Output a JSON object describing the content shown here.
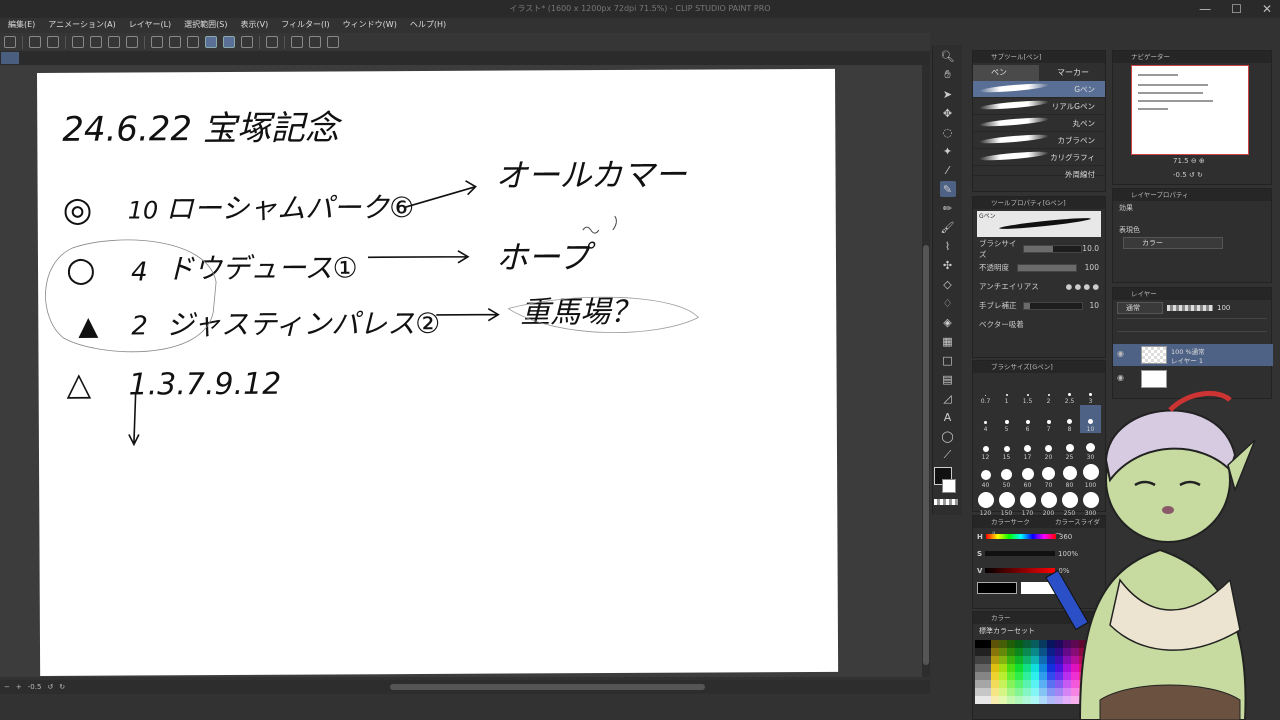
{
  "window": {
    "title": "イラスト* (1600 x 1200px 72dpi 71.5%) - CLIP STUDIO PAINT PRO"
  },
  "menu": [
    "編集(E)",
    "アニメーション(A)",
    "レイヤー(L)",
    "選択範囲(S)",
    "表示(V)",
    "フィルター(I)",
    "ウィンドウ(W)",
    "ヘルプ(H)"
  ],
  "canvas": {
    "title": "24.6.22 宝塚記念",
    "rows": [
      {
        "mark": "◎",
        "num": "10",
        "horse": "ローシャムパーク⑥",
        "note": "オールカマー"
      },
      {
        "mark": "○",
        "num": "4",
        "horse": "ドウデュース①",
        "note": "ホープ"
      },
      {
        "mark": "▲",
        "num": "2",
        "horse": "ジャスティンパレス②",
        "note": "重馬場？"
      },
      {
        "mark": "△",
        "num": "1.3.7.9.12",
        "horse": "",
        "note": ""
      }
    ]
  },
  "status": {
    "zoom": "-0.5"
  },
  "subtool": {
    "title": "サブツール[ペン]",
    "tabs": [
      "ペン",
      "マーカー"
    ],
    "brushes": [
      "Gペン",
      "リアルGペン",
      "丸ペン",
      "カブラペン",
      "カリグラフィ",
      "外周線付"
    ]
  },
  "toolprop": {
    "title": "ツールプロパティ[Gペン]",
    "preset": "Gペン",
    "rows": [
      {
        "label": "ブラシサイズ",
        "value": "10.0",
        "level": 0.5
      },
      {
        "label": "不透明度",
        "value": "100",
        "level": 1.0
      },
      {
        "label": "アンチエイリアス",
        "value": "",
        "level": 0
      },
      {
        "label": "手ブレ補正",
        "value": "10",
        "level": 0.1
      },
      {
        "label": "ベクター吸着",
        "value": "",
        "level": 0
      }
    ]
  },
  "navigator": {
    "title": "ナビゲーター",
    "zoom": "71.5",
    "angle": "-0.5"
  },
  "layerprop": {
    "title": "レイヤープロパティ",
    "effect": "効果",
    "color_label": "表現色",
    "color_value": "カラー"
  },
  "layers": {
    "title": "レイヤー",
    "blend": "通常",
    "opacity": "100",
    "items": [
      {
        "line1": "100 %通常",
        "line2": "レイヤー 1"
      }
    ]
  },
  "brushsize": {
    "title": "ブラシサイズ[Gペン]",
    "sizes": [
      "0.7",
      "1",
      "1.5",
      "2",
      "2.5",
      "3",
      "4",
      "5",
      "6",
      "7",
      "8",
      "10",
      "12",
      "15",
      "17",
      "20",
      "25",
      "30",
      "40",
      "50",
      "60",
      "70",
      "80",
      "100",
      "120",
      "150",
      "170",
      "200",
      "250",
      "300"
    ],
    "selected": "10"
  },
  "colorslider": {
    "tabs": [
      "カラーサークル",
      "カラースライダー"
    ],
    "rows": [
      {
        "ch": "H",
        "val": "360"
      },
      {
        "ch": "S",
        "val": "100%"
      },
      {
        "ch": "V",
        "val": "0%"
      }
    ],
    "modes": [
      "HSV",
      "CMY"
    ]
  },
  "colorset": {
    "tab": "カラー",
    "name": "標準カラーセット"
  },
  "colors": {
    "accent": "#5a6f95",
    "panel": "#2f2f2f",
    "canvas_bg": "#3c3c3c"
  }
}
